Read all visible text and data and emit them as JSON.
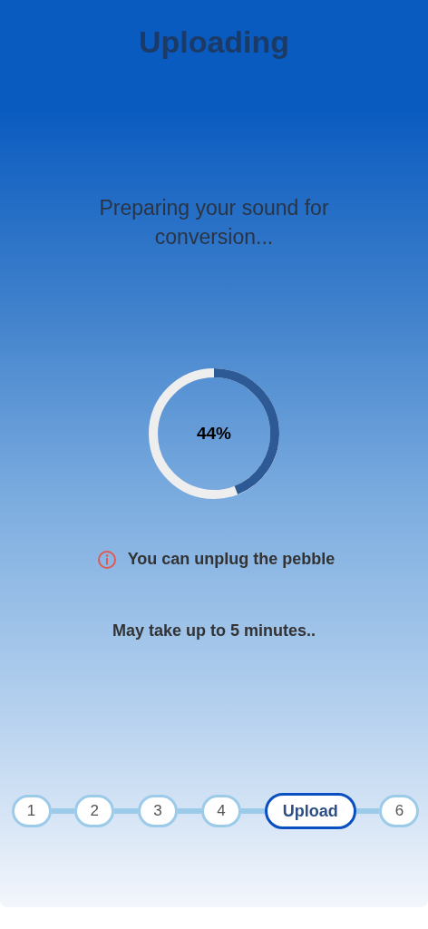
{
  "header": {
    "title": "Uploading"
  },
  "message": "Preparing your sound for conversion...",
  "progress": {
    "level": 0.44,
    "reading": "44%"
  },
  "notice": "You can unplug the pebble",
  "estimate": "May take up to 5 minutes..",
  "steps": [
    {
      "label": "1",
      "selected": false
    },
    {
      "label": "2",
      "selected": false
    },
    {
      "label": "3",
      "selected": false
    },
    {
      "label": "4",
      "selected": false
    },
    {
      "label": "Upload",
      "selected": true
    },
    {
      "label": "6",
      "selected": false
    }
  ]
}
